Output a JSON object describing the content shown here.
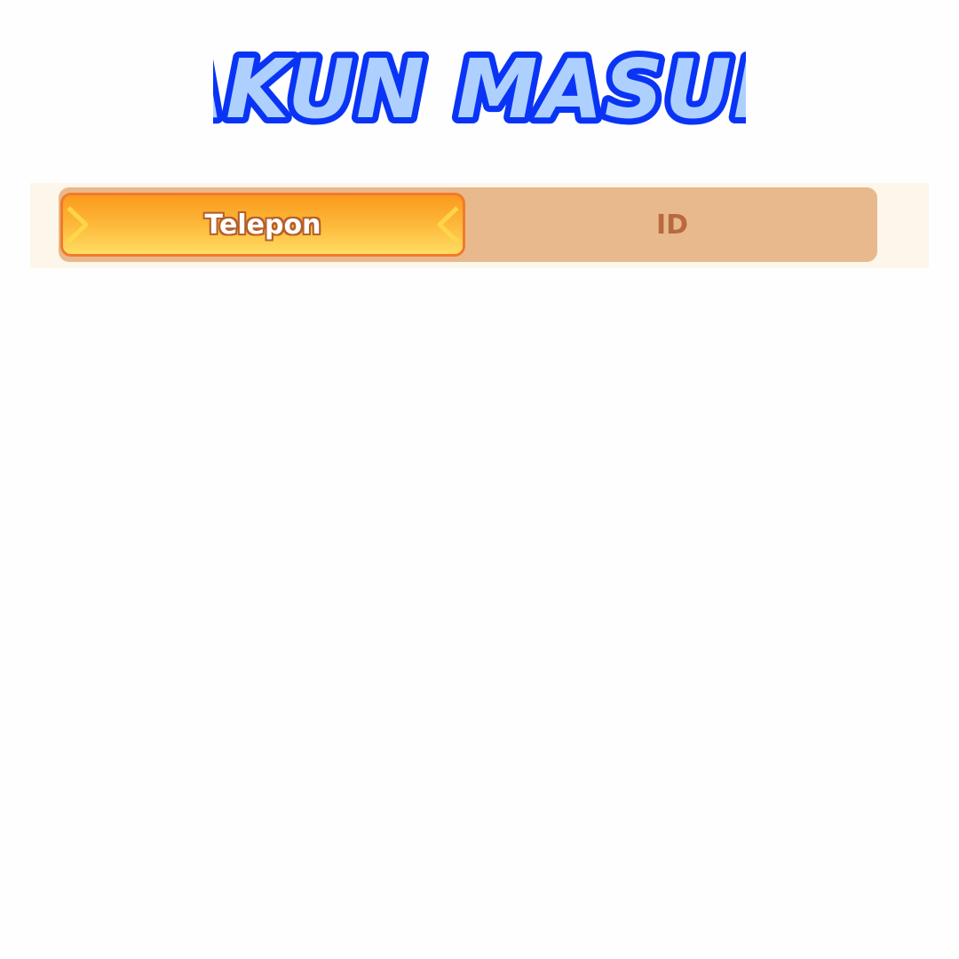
{
  "header": {
    "title": "AKUN MASUK"
  },
  "tabs": [
    {
      "label": "Telepon",
      "active": true
    },
    {
      "label": "ID",
      "active": false
    }
  ],
  "colors": {
    "title_fill": "#aed0ff",
    "title_stroke": "#0a34f5",
    "tab_track": "#e8b98c",
    "tab_active_top": "#fb9a1d",
    "tab_active_bottom": "#ffdd63",
    "tab_inactive_text": "#b86a3e"
  }
}
